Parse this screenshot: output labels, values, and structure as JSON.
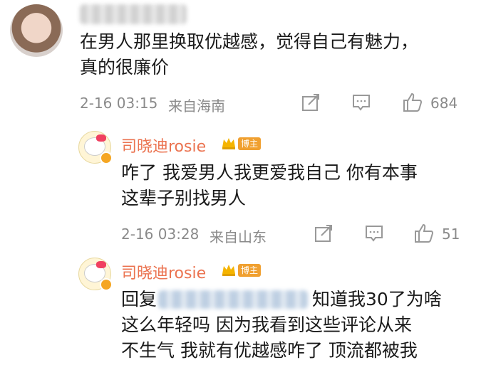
{
  "comment1": {
    "text_line1": "在男人那里换取优越感，觉得自己有魅力，",
    "text_line2": "真的很廉价",
    "time": "2-16 03:15",
    "location": "来自海南",
    "likes": "684"
  },
  "reply1": {
    "username": "司晓迪rosie",
    "badge": "博主",
    "text_line1": "咋了 我爱男人我更爱我自己 你有本事",
    "text_line2": "这辈子别找男人",
    "time": "2-16 03:28",
    "location": "来自山东",
    "likes": "51"
  },
  "reply2": {
    "username": "司晓迪rosie",
    "badge": "博主",
    "prefix": "回复",
    "text_line1_suffix": "知道我30了为啥",
    "text_line2": "这么年轻吗 因为我看到这些评论从来",
    "text_line3": "不生气 我就有优越感咋了 顶流都被我"
  },
  "icons": {
    "forward": "share-icon",
    "comment": "comment-icon",
    "like": "thumbs-up-icon",
    "crown": "crown-icon"
  },
  "colors": {
    "username": "#eb7350",
    "badge": "#f0a030",
    "meta": "#8a8a8a"
  }
}
